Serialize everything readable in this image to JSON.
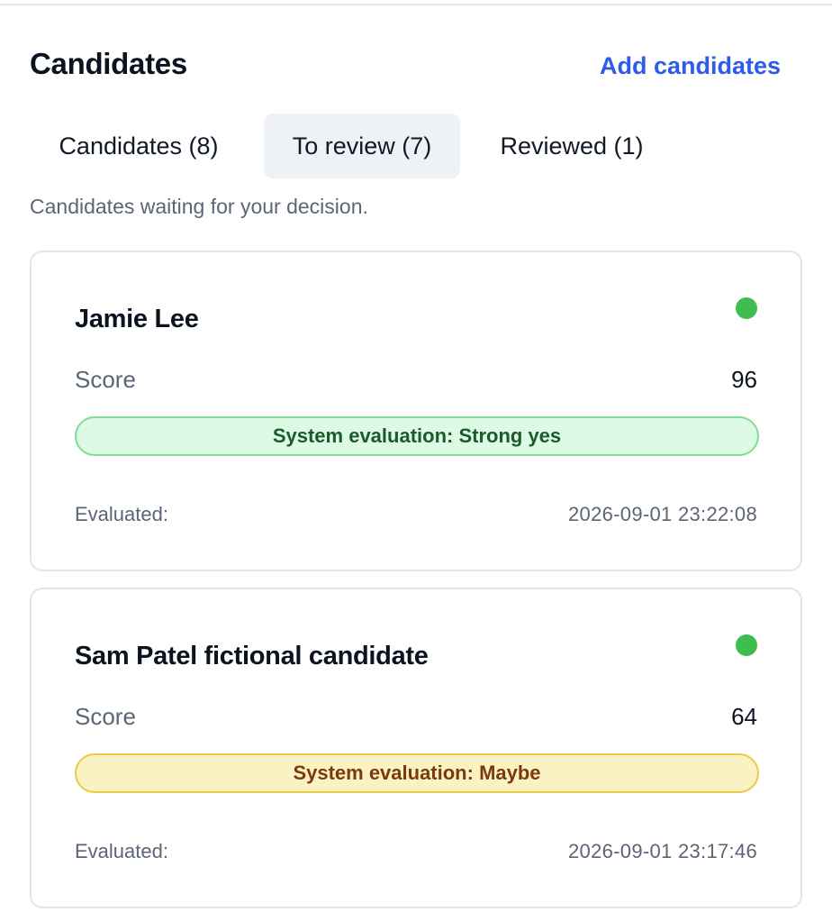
{
  "header": {
    "title": "Candidates",
    "add_link": "Add candidates"
  },
  "tabs": [
    {
      "label": "Candidates (8)",
      "active": false
    },
    {
      "label": "To review (7)",
      "active": true
    },
    {
      "label": "Reviewed (1)",
      "active": false
    }
  ],
  "subtitle": "Candidates waiting for your decision.",
  "candidates": [
    {
      "name": "Jamie Lee",
      "score_label": "Score",
      "score": "96",
      "evaluation": "System evaluation: Strong yes",
      "evaluated_label": "Evaluated:",
      "evaluated_at": "2026-09-01 23:22:08",
      "status_color": "#3ebe4f"
    },
    {
      "name": "Sam Patel fictional candidate",
      "score_label": "Score",
      "score": "64",
      "evaluation": "System evaluation: Maybe",
      "evaluated_label": "Evaluated:",
      "evaluated_at": "2026-09-01 23:17:46",
      "status_color": "#3ebe4f"
    }
  ],
  "colors": {
    "accent": "#2f5bea",
    "strong_yes_bg": "#dcfae4",
    "maybe_bg": "#fbf2c3"
  }
}
